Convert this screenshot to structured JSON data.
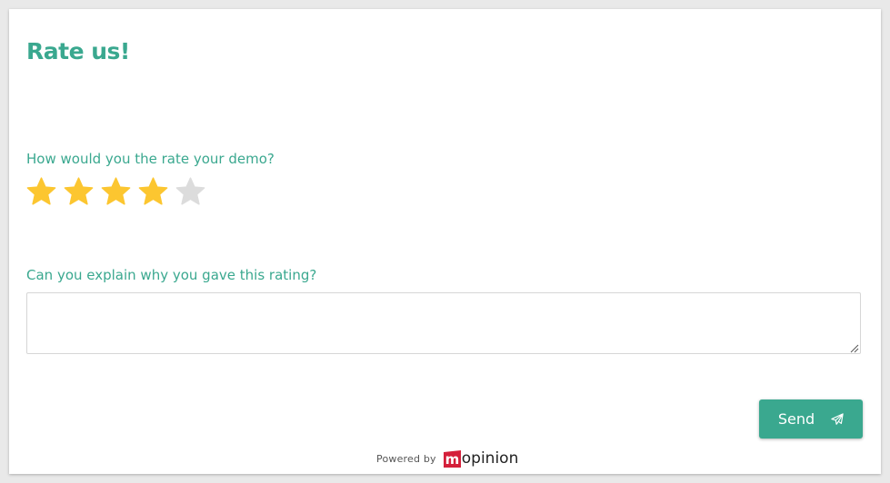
{
  "form": {
    "title": "Rate us!",
    "question_rating": "How would you the rate your demo?",
    "rating": {
      "value": 4,
      "max": 5,
      "filled_color": "#fcc630",
      "empty_color": "#dcdcdc"
    },
    "question_comment": "Can you explain why you gave this rating?",
    "comment": {
      "value": "",
      "placeholder": ""
    },
    "send_label": "Send",
    "send_icon": "paper-plane-icon",
    "accent_color": "#3aa88f"
  },
  "footer": {
    "powered_label": "Powered by",
    "brand_initial": "m",
    "brand_rest": "opinion",
    "brand_color": "#d41f3a"
  }
}
